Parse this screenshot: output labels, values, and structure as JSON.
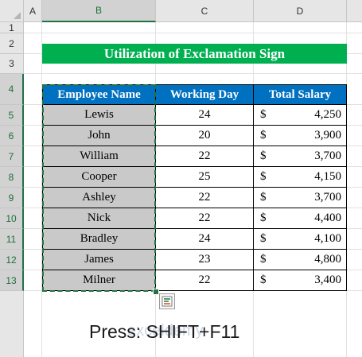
{
  "columns": [
    "A",
    "B",
    "C",
    "D"
  ],
  "rows": [
    "1",
    "2",
    "3",
    "4",
    "5",
    "6",
    "7",
    "8",
    "9",
    "10",
    "11",
    "12",
    "13"
  ],
  "title": "Utilization of Exclamation Sign",
  "table": {
    "headers": [
      "Employee Name",
      "Working Day",
      "Total Salary"
    ],
    "currency": "$",
    "records": [
      {
        "name": "Lewis",
        "days": "24",
        "salary": "4,250"
      },
      {
        "name": "John",
        "days": "20",
        "salary": "3,900"
      },
      {
        "name": "William",
        "days": "22",
        "salary": "3,700"
      },
      {
        "name": "Cooper",
        "days": "25",
        "salary": "4,150"
      },
      {
        "name": "Ashley",
        "days": "22",
        "salary": "3,700"
      },
      {
        "name": "Nick",
        "days": "22",
        "salary": "4,400"
      },
      {
        "name": "Bradley",
        "days": "24",
        "salary": "4,100"
      },
      {
        "name": "James",
        "days": "23",
        "salary": "4,800"
      },
      {
        "name": "Milner",
        "days": "22",
        "salary": "3,400"
      }
    ]
  },
  "caption": "Press: SHIFT+F11",
  "watermark": "exceldemy",
  "selected_column": "B",
  "colors": {
    "title_bg": "#00b050",
    "header_bg": "#0070c0",
    "selected_cells": "#c9c9c9",
    "selection_border": "#217346"
  },
  "icons": {
    "quick_analysis": "quick-analysis-icon",
    "select_all": "select-all-icon"
  }
}
